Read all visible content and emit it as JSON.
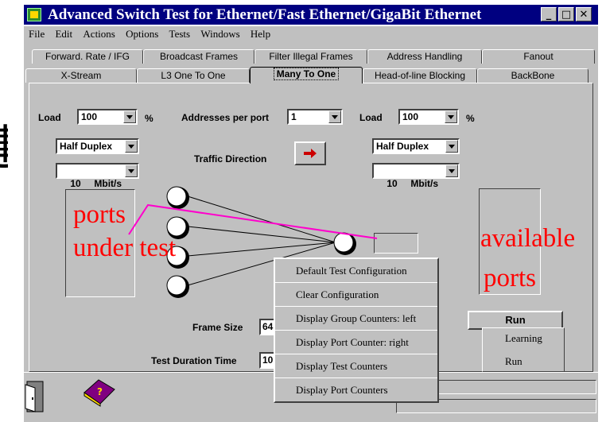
{
  "window": {
    "title": "Advanced Switch Test for Ethernet/Fast Ethernet/GigaBit Ethernet",
    "buttons": {
      "minimize": "_",
      "maximize": "□",
      "close": "✕"
    }
  },
  "menubar": [
    "File",
    "Edit",
    "Actions",
    "Options",
    "Tests",
    "Windows",
    "Help"
  ],
  "tabs": {
    "back_row": [
      "Forward. Rate / IFG",
      "Broadcast Frames",
      "Filter Illegal Frames",
      "Address Handling",
      "Fanout"
    ],
    "front_row": [
      "X-Stream",
      "L3 One To One",
      "Many To One",
      "Head-of-line Blocking",
      "BackBone"
    ],
    "active": "Many To One"
  },
  "left": {
    "load_label": "Load",
    "load_value": "100",
    "load_unit": "%",
    "duplex": "Half Duplex",
    "speed": "10     Mbit/s"
  },
  "middle": {
    "addresses_label": "Addresses per port",
    "addresses_value": "1",
    "traffic_direction_label": "Traffic Direction"
  },
  "right": {
    "load_label": "Load",
    "load_value": "100",
    "load_unit": "%",
    "duplex": "Half Duplex",
    "speed": "10     Mbit/s"
  },
  "bottom": {
    "frame_size_label": "Frame Size",
    "frame_size_value": "64",
    "duration_label": "Test Duration Time",
    "duration_value": "10",
    "run_label": "Run"
  },
  "context_menu": [
    "Default Test Configuration",
    "Clear Configuration",
    "Display Group Counters: left",
    "Display Port Counter: right",
    "Display Test Counters",
    "Display Port Counters"
  ],
  "run_menu": [
    "Learning",
    "Run"
  ],
  "annotations": {
    "ports_under_test_line1": "ports",
    "ports_under_test_line2": "under test",
    "available_line1": "available",
    "available_line2": "ports",
    "left_char": "連"
  },
  "colors": {
    "annotation": "#ff0000",
    "connector_line": "#ff00cc",
    "titlebar": "#000080",
    "direction_arrow": "#cc0000"
  }
}
